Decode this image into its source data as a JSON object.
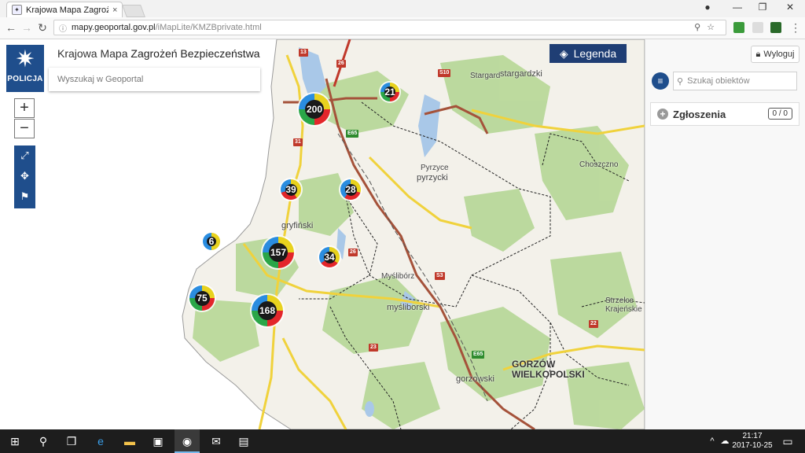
{
  "browser": {
    "tab_title": "Krajowa Mapa Zagrożeń",
    "tab_close": "×",
    "url_host": "mapy.geoportal.gov.pl",
    "url_path": "/iMapLite/KMZBprivate.html"
  },
  "app": {
    "brand_label": "POLICJA",
    "title_regular": "Krajowa Mapa ",
    "title_bold": "Zagrożeń Bezpieczeństwa",
    "search_placeholder": "Wyszukaj w Geoportal",
    "legend_label": "Legenda",
    "zoom_in": "+",
    "zoom_out": "−"
  },
  "clusters": [
    {
      "label": "200"
    },
    {
      "label": "21"
    },
    {
      "label": "39"
    },
    {
      "label": "28"
    },
    {
      "label": "6"
    },
    {
      "label": "157"
    },
    {
      "label": "34"
    },
    {
      "label": "75"
    },
    {
      "label": "168"
    }
  ],
  "map_labels": {
    "stargard": "Stargard",
    "stargardzki": "stargardzki",
    "pyrzyce": "Pyrzyce",
    "pyrzycki": "pyrzycki",
    "choszczno": "Choszczno",
    "gryfinski": "gryfiński",
    "mysliborz": "Myślibórz",
    "mysliborski": "myśliborski",
    "strzelce1": "Strzelce",
    "strzelce2": "Krajeńskie",
    "gorzow1": "GORZÓW",
    "gorzow2": "WIELKOPOLSKI",
    "gorzowski": "gorzowski"
  },
  "road_badges": {
    "r13": "13",
    "r26a": "26",
    "r10": "S10",
    "e65a": "E65",
    "r31": "31",
    "r26b": "26",
    "s3": "S3",
    "r22": "22",
    "r23": "23",
    "e65b": "E65"
  },
  "side_panel": {
    "logout_label": "Wyloguj",
    "search_placeholder": "Szukaj obiektów",
    "reports_label": "Zgłoszenia",
    "reports_count": "0 / 0"
  },
  "taskbar": {
    "time": "21:17",
    "date": "2017-10-25"
  },
  "colors": {
    "brand": "#1f4e8c",
    "legend_bg": "#1f3e74",
    "fab": "#e0202e",
    "map_land": "#f3f1ea",
    "forest": "#b9d89a",
    "water": "#a9c8e8"
  }
}
